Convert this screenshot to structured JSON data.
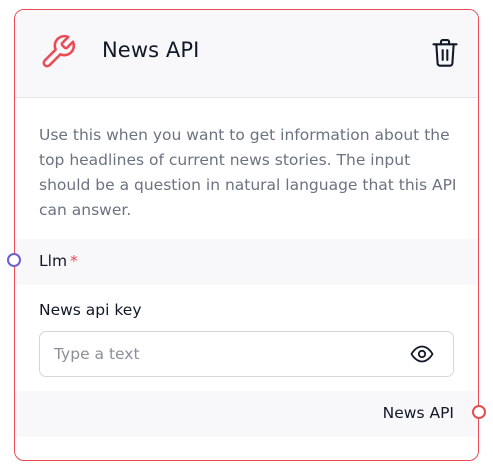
{
  "node": {
    "title": "News API",
    "description": "Use this when you want to get information about the top headlines of current news stories. The input should be a question in natural language that this API can answer.",
    "icon": "wrench-icon",
    "delete_icon": "trash-icon",
    "accent_color": "#ea4b55"
  },
  "fields": {
    "llm": {
      "label": "Llm",
      "required_mark": "*"
    },
    "api_key": {
      "label": "News api key",
      "value": "",
      "placeholder": "Type a text",
      "toggle_icon": "eye-icon"
    }
  },
  "output": {
    "label": "News API"
  },
  "handles": {
    "input_color": "#6b5fd3",
    "output_color": "#ea4b55"
  }
}
